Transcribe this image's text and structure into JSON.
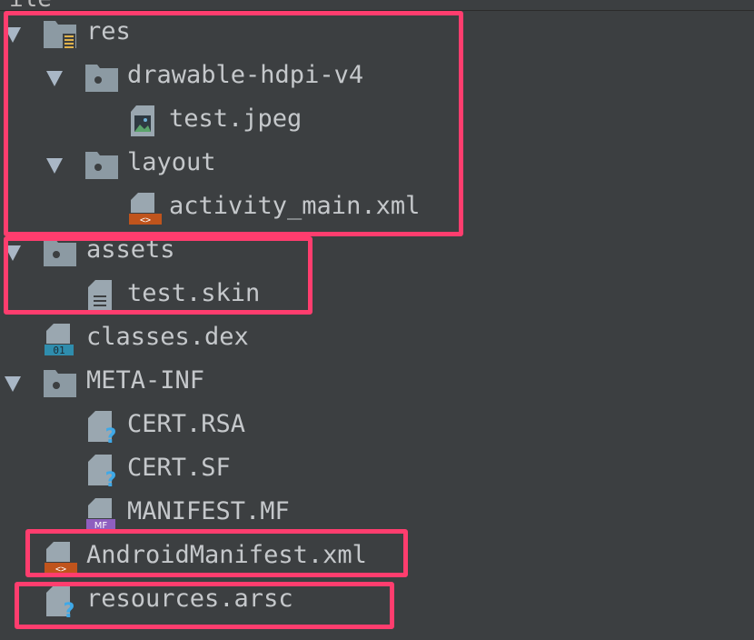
{
  "window": {
    "partial_title": "ile"
  },
  "tree": [
    {
      "label": "res",
      "expanded": true,
      "icon": "resource-folder-icon"
    },
    {
      "label": "drawable-hdpi-v4",
      "expanded": true,
      "icon": "folder-icon"
    },
    {
      "label": "test.jpeg",
      "icon": "image-file-icon"
    },
    {
      "label": "layout",
      "expanded": true,
      "icon": "folder-icon"
    },
    {
      "label": "activity_main.xml",
      "icon": "xml-file-icon"
    },
    {
      "label": "assets",
      "expanded": true,
      "icon": "folder-icon"
    },
    {
      "label": "test.skin",
      "icon": "text-file-icon"
    },
    {
      "label": "classes.dex",
      "icon": "dex-file-icon",
      "badge": "01"
    },
    {
      "label": "META-INF",
      "expanded": true,
      "icon": "folder-icon"
    },
    {
      "label": "CERT.RSA",
      "icon": "unknown-file-icon"
    },
    {
      "label": "CERT.SF",
      "icon": "unknown-file-icon"
    },
    {
      "label": "MANIFEST.MF",
      "icon": "manifest-file-icon",
      "badge": "MF"
    },
    {
      "label": "AndroidManifest.xml",
      "icon": "xml-file-icon"
    },
    {
      "label": "resources.arsc",
      "icon": "unknown-file-icon"
    }
  ],
  "colors": {
    "background": "#3c3f41",
    "text": "#c5c8cb",
    "highlight": "#ff3d6e",
    "folder": "#8c9aa3"
  }
}
